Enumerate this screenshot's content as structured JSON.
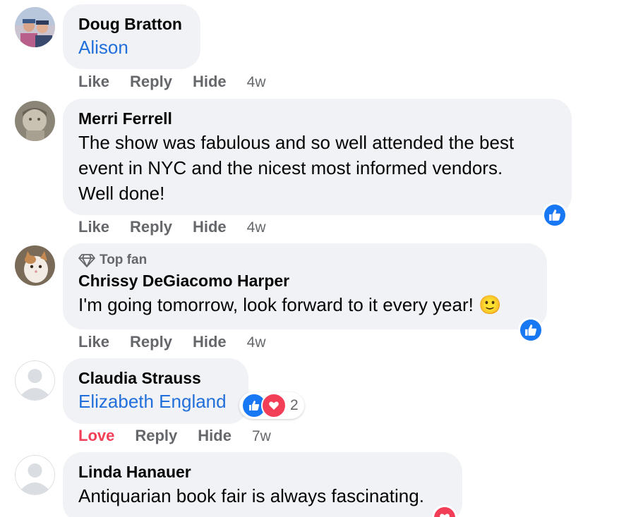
{
  "actions": {
    "like": "Like",
    "love": "Love",
    "reply": "Reply",
    "hide": "Hide"
  },
  "comments": [
    {
      "author": "Doug Bratton",
      "tag": "Alison",
      "time": "4w"
    },
    {
      "author": "Merri Ferrell",
      "text_lines": [
        "The show was fabulous and so well attended the best",
        "event in NYC and the nicest most informed vendors.",
        "Well done!"
      ],
      "time": "4w",
      "reaction": "like"
    },
    {
      "badge": "Top fan",
      "author": "Chrissy DeGiacomo Harper",
      "text": "I'm going tomorrow, look forward to it every year!",
      "emoji": "🙂",
      "time": "4w",
      "reaction": "like"
    },
    {
      "author": "Claudia Strauss",
      "tag": "Elizabeth England",
      "time": "7w",
      "reactions": [
        "like",
        "love"
      ],
      "reaction_count": "2",
      "user_reacted": "Love"
    },
    {
      "author": "Linda Hanauer",
      "text": "Antiquarian book fair is always fascinating.",
      "reaction": "love"
    }
  ],
  "colors": {
    "bubble": "#f0f2f5",
    "link": "#216fdb",
    "meta": "#65676b",
    "like_blue": "#1877f2",
    "love_red": "#f33e58"
  }
}
